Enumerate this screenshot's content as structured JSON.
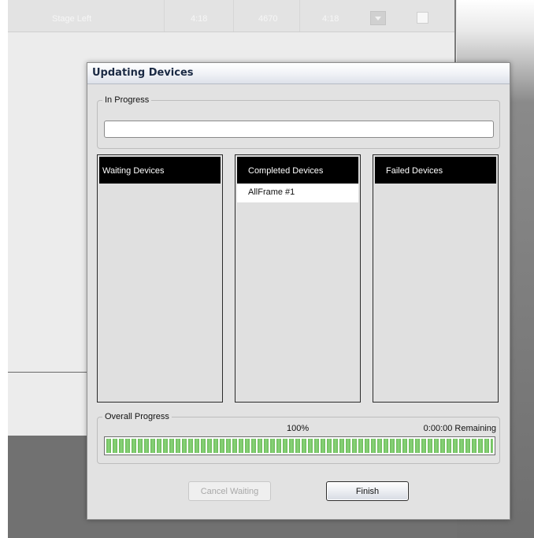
{
  "background_window": {
    "row": {
      "name": "Stage Left",
      "col_a": "4:18",
      "col_b": "4670",
      "col_c": "4:18"
    }
  },
  "dialog": {
    "title": "Updating Devices",
    "in_progress": {
      "label": "In Progress",
      "value": ""
    },
    "panels": {
      "waiting": {
        "header": "Waiting Devices",
        "items": []
      },
      "completed": {
        "header": "Completed Devices",
        "items": [
          "AllFrame #1"
        ]
      },
      "failed": {
        "header": "Failed Devices",
        "items": []
      }
    },
    "overall_progress": {
      "label": "Overall Progress",
      "percent_text": "100%",
      "percent": 100,
      "remaining": "0:00:00 Remaining"
    },
    "buttons": {
      "cancel_waiting": "Cancel Waiting",
      "finish": "Finish"
    }
  },
  "colors": {
    "progress_green": "#6cba5a",
    "panel_header_bg": "#000000",
    "dialog_bg": "#e2e2e2"
  }
}
